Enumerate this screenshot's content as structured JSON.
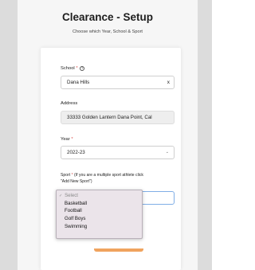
{
  "header": {
    "title": "Clearance - Setup",
    "subtitle": "Choose which Year, School & Sport"
  },
  "form": {
    "school": {
      "label": "School",
      "required_mark": "*",
      "help_icon": "?",
      "value": "Dana Hills",
      "clear": "x"
    },
    "address": {
      "label": "Address",
      "value": "33333 Golden Lantern Dana Point, Cal"
    },
    "year": {
      "label": "Year",
      "required_mark": "*",
      "value": "2022-23",
      "chevron": "⌄"
    },
    "sport": {
      "label": "Sport",
      "required_mark": "*",
      "hint_line1": " (If you are a multiple sport athlete click",
      "hint_line2": "\"Add New Sport\")"
    }
  },
  "dropdown": {
    "check": "✓",
    "placeholder": "Select",
    "options": [
      "Basketball",
      "Football",
      "Golf Boys",
      "Swimming"
    ]
  },
  "colors": {
    "required": "#d9534f",
    "button_accent": "#f0a35e",
    "focus_border": "#80aee6"
  }
}
